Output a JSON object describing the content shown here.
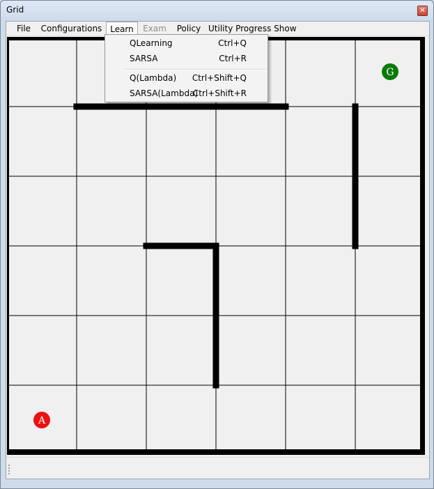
{
  "window": {
    "title": "Grid"
  },
  "menu": {
    "items": [
      {
        "label": "File",
        "state": "normal"
      },
      {
        "label": "Configurations",
        "state": "normal"
      },
      {
        "label": "Learn",
        "state": "open"
      },
      {
        "label": "Exam",
        "state": "disabled"
      },
      {
        "label": "Policy",
        "state": "normal"
      },
      {
        "label": "Utility Progress Show",
        "state": "normal"
      }
    ]
  },
  "learn_menu": {
    "items": [
      {
        "label": "QLearning",
        "shortcut": "Ctrl+Q"
      },
      {
        "label": "SARSA",
        "shortcut": "Ctrl+R"
      },
      {
        "label": "Q(Lambda)",
        "shortcut": "Ctrl+Shift+Q"
      },
      {
        "label": "SARSA(Lambda)",
        "shortcut": "Ctrl+Shift+R"
      }
    ]
  },
  "grid": {
    "rows": 6,
    "cols": 6,
    "agent": {
      "label": "A",
      "row": 5,
      "col": 0,
      "color": "#ee1111"
    },
    "goal": {
      "label": "G",
      "row": 0,
      "col": 5,
      "color": "#0a7a0a"
    },
    "walls": [
      {
        "row": 1,
        "col": 1,
        "side": "top"
      },
      {
        "row": 1,
        "col": 2,
        "side": "top"
      },
      {
        "row": 1,
        "col": 3,
        "side": "top"
      },
      {
        "row": 1,
        "col": 5,
        "side": "left"
      },
      {
        "row": 2,
        "col": 5,
        "side": "left"
      },
      {
        "row": 3,
        "col": 2,
        "side": "top"
      },
      {
        "row": 3,
        "col": 3,
        "side": "left"
      },
      {
        "row": 4,
        "col": 3,
        "side": "left"
      }
    ],
    "colors": {
      "cell": "#f0f0f0",
      "line": "#000000"
    }
  }
}
